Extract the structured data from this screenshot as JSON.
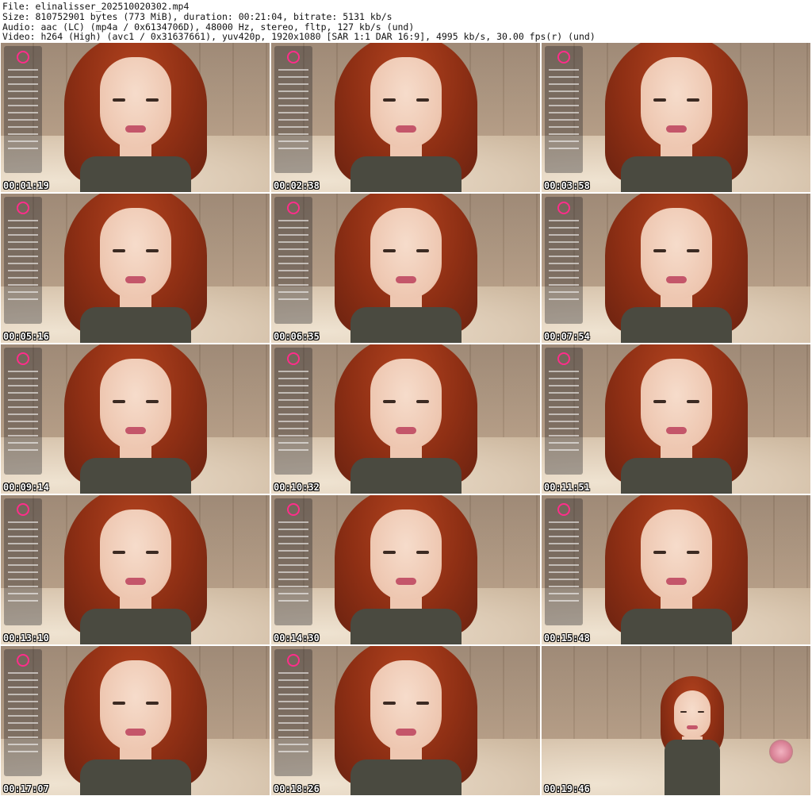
{
  "header": {
    "file": "File: elinalisser_202510020302.mp4",
    "size": "Size: 810752901 bytes (773 MiB), duration: 00:21:04, bitrate: 5131 kb/s",
    "audio": "Audio: aac (LC) (mp4a / 0x6134706D), 48000 Hz, stereo, fltp, 127 kb/s (und)",
    "video": "Video: h264 (High) (avc1 / 0x31637661), yuv420p, 1920x1080 [SAR 1:1 DAR 16:9], 4995 kb/s, 30.00 fps(r) (und)"
  },
  "thumbnails": [
    {
      "timestamp": "00:01:19"
    },
    {
      "timestamp": "00:02:38"
    },
    {
      "timestamp": "00:03:58"
    },
    {
      "timestamp": "00:05:16"
    },
    {
      "timestamp": "00:06:35"
    },
    {
      "timestamp": "00:07:54"
    },
    {
      "timestamp": "00:09:14"
    },
    {
      "timestamp": "00:10:32"
    },
    {
      "timestamp": "00:11:51"
    },
    {
      "timestamp": "00:13:10"
    },
    {
      "timestamp": "00:14:30"
    },
    {
      "timestamp": "00:15:48"
    },
    {
      "timestamp": "00:17:07"
    },
    {
      "timestamp": "00:18:26"
    },
    {
      "timestamp": "00:19:46"
    }
  ]
}
